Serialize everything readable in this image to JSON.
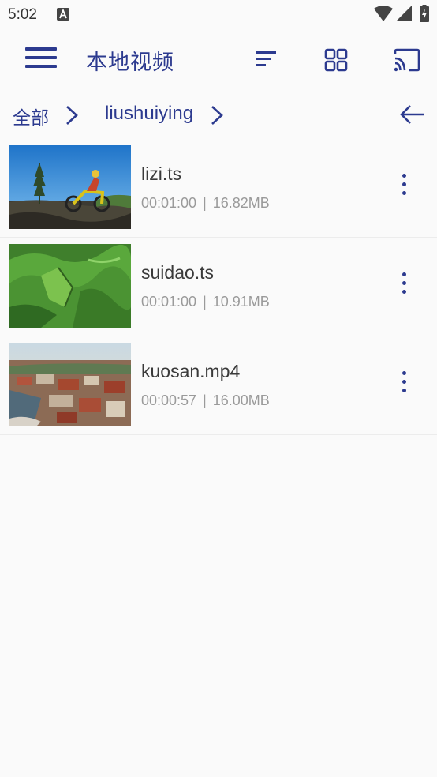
{
  "status": {
    "time": "5:02"
  },
  "appbar": {
    "title": "本地视频",
    "icons": {
      "menu": "hamburger-menu-icon",
      "sort": "sort-icon",
      "grid": "grid-view-icon",
      "cast": "cast-icon"
    }
  },
  "breadcrumb": {
    "root": "全部",
    "folder": "liushuiying",
    "back_icon": "arrow-left-icon"
  },
  "videos": [
    {
      "name": "lizi.ts",
      "duration": "00:01:00",
      "separator": "|",
      "size": "16.82MB",
      "thumbnail": "motocross-rider"
    },
    {
      "name": "suidao.ts",
      "duration": "00:01:00",
      "separator": "|",
      "size": "10.91MB",
      "thumbnail": "green-terrain"
    },
    {
      "name": "kuosan.mp4",
      "duration": "00:00:57",
      "separator": "|",
      "size": "16.00MB",
      "thumbnail": "aerial-town"
    }
  ],
  "colors": {
    "accent": "#2c3a8f",
    "background": "#fafafa",
    "meta_text": "#9a9a9a"
  }
}
